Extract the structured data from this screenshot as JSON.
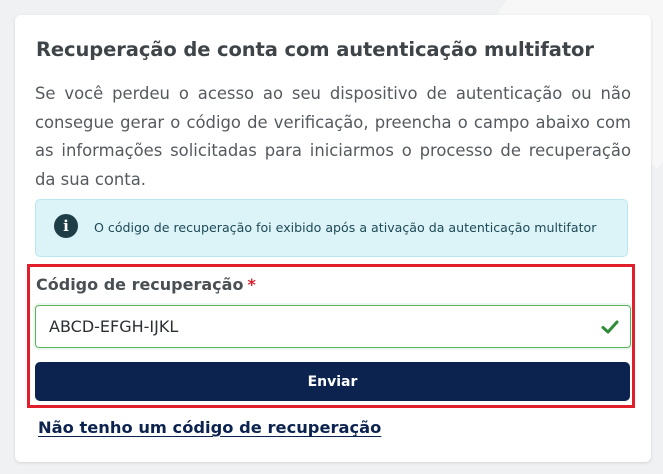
{
  "card": {
    "title": "Recuperação de conta com autenticação multifator",
    "description": "Se você perdeu o acesso ao seu dispositivo de autenticação ou não consegue gerar o código de verificação, preencha o campo abaixo com as informações solicitadas para iniciarmos o processo de recuperação da sua conta.",
    "info": {
      "icon": "info-icon",
      "icon_glyph": "i",
      "text": "O código de recuperação foi exibido após a ativação da autenticação multifator"
    },
    "field": {
      "label": "Código de recuperação",
      "required_mark": "*",
      "value": "ABCD-EFGH-IJKL",
      "status_icon": "check-icon"
    },
    "submit_label": "Enviar",
    "no_code_link": "Não tenho um código de recuperação"
  },
  "colors": {
    "primary": "#0c2350",
    "info_bg": "#dcf3f8",
    "valid": "#2e8b36",
    "required": "#d62330",
    "highlight": "#e11e2b"
  }
}
